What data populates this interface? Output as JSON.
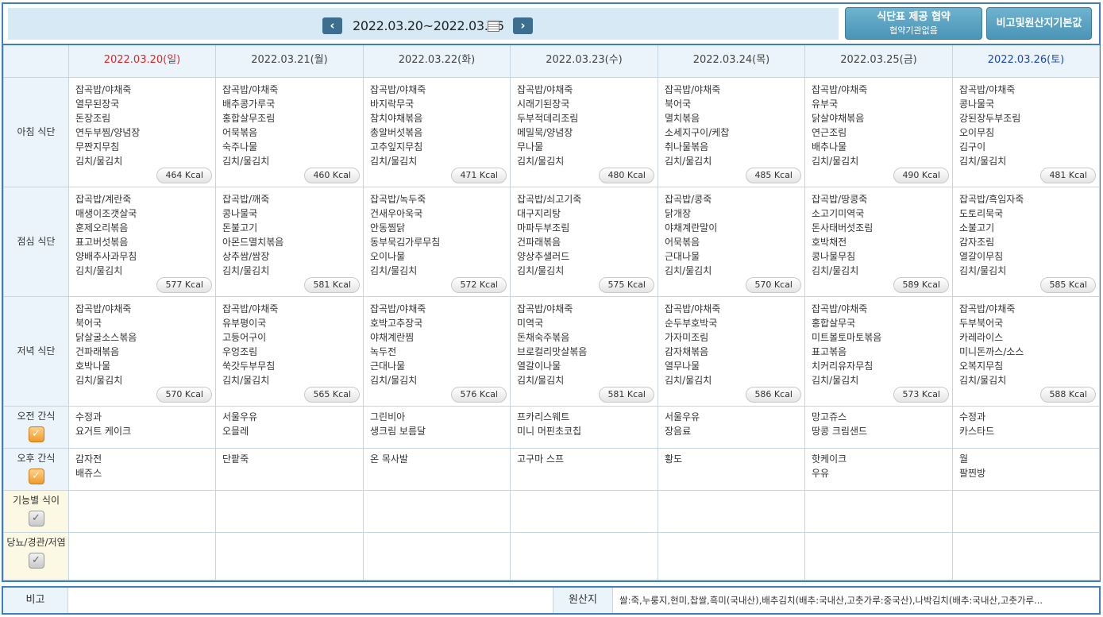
{
  "nav": {
    "prev_icon": "chevron-left-icon",
    "next_icon": "chevron-right-icon",
    "week_range": "2022.03.20~2022.03.26",
    "calendar_icon": "calendar-icon"
  },
  "buttons": {
    "contract_title": "식단표 제공 협약",
    "contract_sub": "협약기관없음",
    "basic_info": "비고및원산지기본값"
  },
  "days": [
    "2022.03.20(일)",
    "2022.03.21(월)",
    "2022.03.22(화)",
    "2022.03.23(수)",
    "2022.03.24(목)",
    "2022.03.25(금)",
    "2022.03.26(토)"
  ],
  "colors": {
    "sunday": "#d62828",
    "saturday": "#1c46c0",
    "accent": "#3f7fbf",
    "checkbox": "#f19a2a"
  },
  "meals": [
    {
      "label": "아침 식단",
      "days": [
        {
          "items": [
            "잡곡밥/야채죽",
            "열무된장국",
            "돈장조림",
            "연두부찜/양념장",
            "무짠지무침",
            "김치/물김치"
          ],
          "kcal": "464 Kcal"
        },
        {
          "items": [
            "잡곡밥/야채죽",
            "배추콩가루국",
            "홍합살무조림",
            "어묵볶음",
            "숙주나물",
            "김치/물김치"
          ],
          "kcal": "460 Kcal"
        },
        {
          "items": [
            "잡곡밥/야채죽",
            "바지락무국",
            "참치야채볶음",
            "총알버섯볶음",
            "고추잎지무침",
            "김치/물김치"
          ],
          "kcal": "471 Kcal"
        },
        {
          "items": [
            "잡곡밥/야채죽",
            "시래기된장국",
            "두부적데리조림",
            "메밀묵/양념장",
            "무나물",
            "김치/물김치"
          ],
          "kcal": "480 Kcal"
        },
        {
          "items": [
            "잡곡밥/야채죽",
            "북어국",
            "멸치볶음",
            "소세지구이/케찹",
            "취나물볶음",
            "김치/물김치"
          ],
          "kcal": "485 Kcal"
        },
        {
          "items": [
            "잡곡밥/야채죽",
            "유부국",
            "닭살야채볶음",
            "연근조림",
            "배추나물",
            "김치/물김치"
          ],
          "kcal": "490 Kcal"
        },
        {
          "items": [
            "잡곡밥/야채죽",
            "콩나물국",
            "강된장두부조림",
            "오이무침",
            "김구이",
            "김치/물김치"
          ],
          "kcal": "481 Kcal"
        }
      ]
    },
    {
      "label": "점심 식단",
      "days": [
        {
          "items": [
            "잡곡밥/계란죽",
            "매생이조갯살국",
            "훈제오리볶음",
            "표고버섯볶음",
            "양배추사과무침",
            "김치/물김치"
          ],
          "kcal": "577 Kcal"
        },
        {
          "items": [
            "잡곡밥/깨죽",
            "콩나물국",
            "돈불고기",
            "아몬드멸치볶음",
            "상추쌈/쌈장",
            "김치/물김치"
          ],
          "kcal": "581 Kcal"
        },
        {
          "items": [
            "잡곡밥/녹두죽",
            "건새우아욱국",
            "안동찜닭",
            "동부묵김가루무침",
            "오이나물",
            "김치/물김치"
          ],
          "kcal": "572 Kcal"
        },
        {
          "items": [
            "잡곡밥/쇠고기죽",
            "대구지리탕",
            "마파두부조림",
            "건파래볶음",
            "양상추샐러드",
            "김치/물김치"
          ],
          "kcal": "575 Kcal"
        },
        {
          "items": [
            "잡곡밥/콩죽",
            "닭개장",
            "야채계란말이",
            "어묵볶음",
            "근대나물",
            "김치/물김치"
          ],
          "kcal": "570 Kcal"
        },
        {
          "items": [
            "잡곡밥/땅콩죽",
            "소고기미역국",
            "돈사태버섯조림",
            "호박채전",
            "콩나물무침",
            "김치/물김치"
          ],
          "kcal": "589 Kcal"
        },
        {
          "items": [
            "잡곡밥/흑임자죽",
            "도토리묵국",
            "소불고기",
            "감자조림",
            "열갈이무침",
            "김치/물김치"
          ],
          "kcal": "585 Kcal"
        }
      ]
    },
    {
      "label": "저녁 식단",
      "days": [
        {
          "items": [
            "잡곡밥/야채죽",
            "북어국",
            "닭살굴소스볶음",
            "건파래볶음",
            "호박나물",
            "김치/물김치"
          ],
          "kcal": "570 Kcal"
        },
        {
          "items": [
            "잡곡밥/야채죽",
            "유부평이국",
            "고등어구이",
            "우엉조림",
            "쑥갓두부무침",
            "김치/물김치"
          ],
          "kcal": "565 Kcal"
        },
        {
          "items": [
            "잡곡밥/야채죽",
            "호박고추장국",
            "야채계란찜",
            "녹두전",
            "근대나물",
            "김치/물김치"
          ],
          "kcal": "576 Kcal"
        },
        {
          "items": [
            "잡곡밥/야채죽",
            "미역국",
            "돈채숙주볶음",
            "브로컬리맛살볶음",
            "열갈이나물",
            "김치/물김치"
          ],
          "kcal": "581 Kcal"
        },
        {
          "items": [
            "잡곡밥/야채죽",
            "순두부호박국",
            "가자미조림",
            "감자채볶음",
            "열무나물",
            "김치/물김치"
          ],
          "kcal": "586 Kcal"
        },
        {
          "items": [
            "잡곡밥/야채죽",
            "홍합살무국",
            "미트볼토마토볶음",
            "표고볶음",
            "치커리유자무침",
            "김치/물김치"
          ],
          "kcal": "573 Kcal"
        },
        {
          "items": [
            "잡곡밥/야채죽",
            "두부북어국",
            "카레라이스",
            "미니돈까스/소스",
            "오복지무침",
            "김치/물김치"
          ],
          "kcal": "588 Kcal"
        }
      ]
    }
  ],
  "snacks": [
    {
      "label": "오전 간식",
      "checked": true,
      "days": [
        [
          "수정과",
          "요거트 케이크"
        ],
        [
          "서울우유",
          "오믈레"
        ],
        [
          "그린비아",
          "생크림 보름달"
        ],
        [
          "프카리스웨트",
          "미니 머핀초코칩"
        ],
        [
          "서울우유",
          "장음료"
        ],
        [
          "망고쥬스",
          "땅콩 크림샌드"
        ],
        [
          "수정과",
          "카스타드"
        ]
      ]
    },
    {
      "label": "오후 간식",
      "checked": true,
      "days": [
        [
          "감자전",
          "배쥬스"
        ],
        [
          "단팥죽"
        ],
        [
          "온 목사발"
        ],
        [
          "고구마 스프"
        ],
        [
          "황도"
        ],
        [
          "핫케이크",
          "우유"
        ],
        [
          "월",
          "팔찐방"
        ]
      ]
    },
    {
      "label": "기능별 식이",
      "checked": false,
      "days": [
        [],
        [],
        [],
        [],
        [],
        [],
        []
      ]
    },
    {
      "label": "당뇨/경관/저염",
      "checked": false,
      "days": [
        [],
        [],
        [],
        [],
        [],
        [],
        []
      ]
    }
  ],
  "footer": {
    "remark_label": "비고",
    "remark_value": "",
    "origin_label": "원산지",
    "origin_value": "쌀:죽,누룽지,현미,찹쌀,흑미(국내산),배추김치(배추:국내산,고춧가루:중국산),나박김치(배추:국내산,고춧가루..."
  }
}
